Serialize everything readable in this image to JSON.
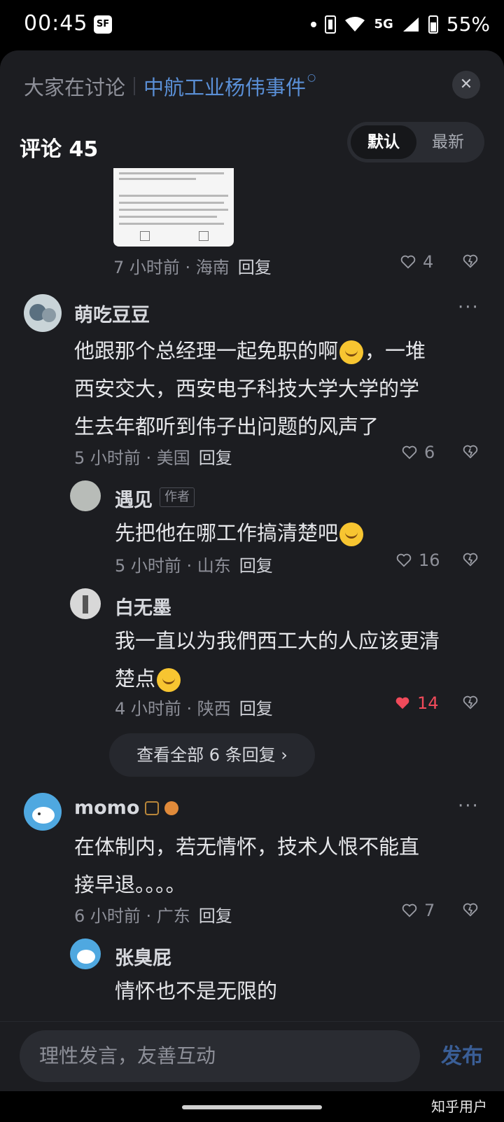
{
  "status_bar": {
    "time": "00:45",
    "network": "5G",
    "battery": "55%",
    "sf_badge": "SF"
  },
  "topic_bar": {
    "prefix": "大家在讨论",
    "topic": "中航工业杨伟事件",
    "close_icon": "close-icon"
  },
  "comments_header": {
    "title": "评论 45",
    "sort_default": "默认",
    "sort_latest": "最新"
  },
  "comments": [
    {
      "meta": "7 小时前 · 海南",
      "reply": "回复",
      "likes": "4"
    },
    {
      "user": "萌吃豆豆",
      "text_line1": "他跟那个总经理一起免职的啊",
      "text_line1b": "，一堆",
      "text_line2": "西安交大，西安电子科技大学大学的学",
      "text_line3": "生去年都听到伟子出问题的风声了",
      "meta": "5 小时前 · 美国",
      "reply": "回复",
      "likes": "6",
      "replies": [
        {
          "user": "遇见",
          "tag": "作者",
          "text": "先把他在哪工作搞清楚吧",
          "meta": "5 小时前 · 山东",
          "reply": "回复",
          "likes": "16"
        },
        {
          "user": "白无墨",
          "text_line1": "我一直以为我們西工大的人应该更清",
          "text_line2": "楚点",
          "meta": "4 小时前 · 陕西",
          "reply": "回复",
          "likes": "14",
          "liked": true
        }
      ],
      "view_all": "查看全部 6 条回复 ›"
    },
    {
      "user": "momo",
      "text_line1": "在体制内，若无情怀，技术人恨不能直",
      "text_line2": "接早退。。。。",
      "meta": "6 小时前 · 广东",
      "reply": "回复",
      "likes": "7",
      "replies": [
        {
          "user": "张臭屁",
          "text": "情怀也不是无限的"
        }
      ]
    }
  ],
  "input_bar": {
    "placeholder": "理性发言，友善互动",
    "publish": "发布"
  },
  "watermark": "知乎用户",
  "colors": {
    "sheet": "#1c1d21",
    "accent": "#5a8fd6",
    "liked": "#f04a5a"
  }
}
